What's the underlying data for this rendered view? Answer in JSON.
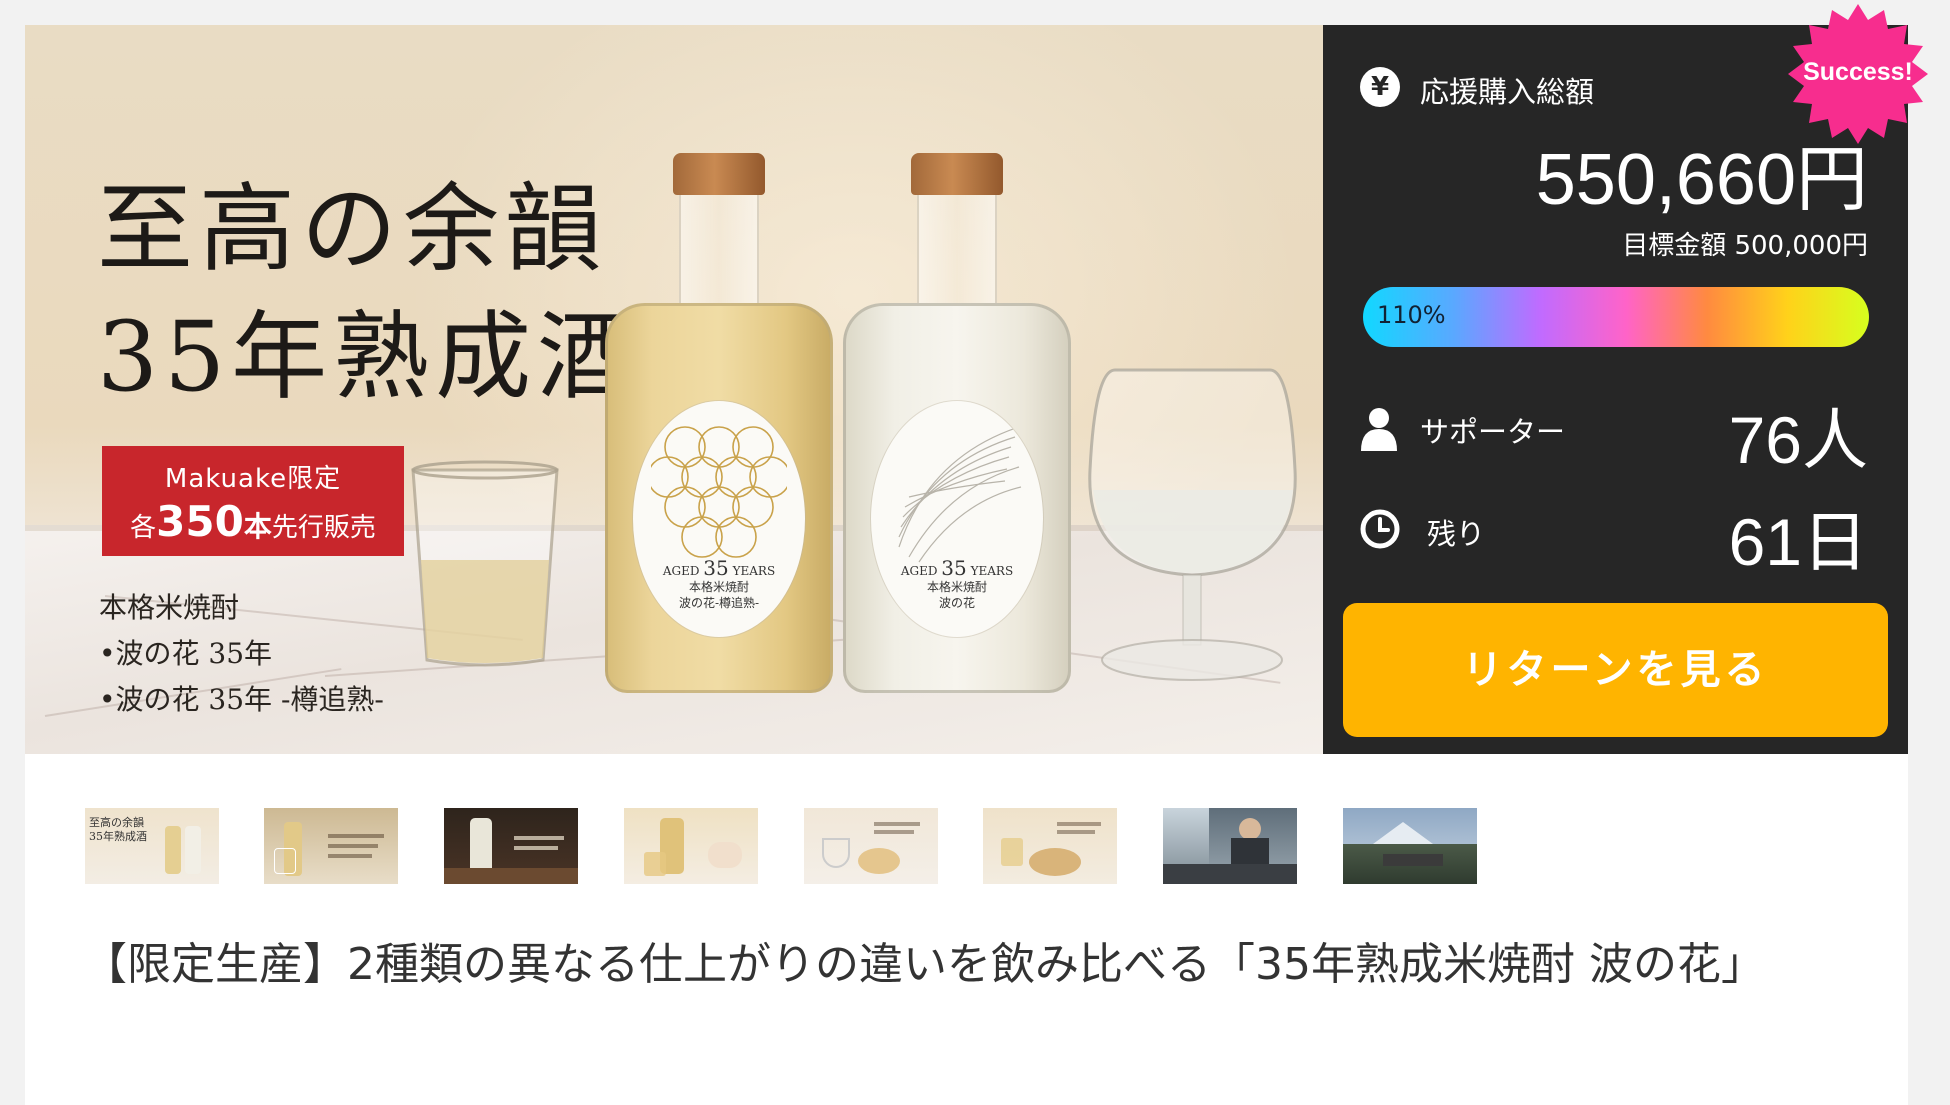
{
  "hero": {
    "title": "至高の余韻\n35年熟成酒",
    "badge_line1": "Makuake限定",
    "badge_prefix": "各",
    "badge_number": "350",
    "badge_unit": "本",
    "badge_suffix": "先行販売",
    "sub_lines": [
      "本格米焼酎",
      "•波の花 35年",
      "•波の花 35年 -樽追熟-"
    ],
    "bottle_left_label": [
      "AGED",
      "35",
      "YEARS",
      "本格米焼酎",
      "波の花-樽追熟-"
    ],
    "bottle_right_label": [
      "AGED",
      "35",
      "YEARS",
      "本格米焼酎",
      "波の花"
    ]
  },
  "panel": {
    "total_label": "応援購入総額",
    "total_icon": "yen-icon",
    "total_value": "550,660円",
    "goal_text": "目標金額 500,000円",
    "progress_percent": 110,
    "progress_label": "110%",
    "supporters_label": "サポーター",
    "supporters_icon": "person-icon",
    "supporters_value": "76人",
    "remaining_label": "残り",
    "remaining_icon": "clock-icon",
    "remaining_value": "61日",
    "cta_label": "リターンを見る",
    "success_label": "Success!",
    "colors": {
      "panel_bg": "#262626",
      "cta": "#ffb400",
      "success": "#f72d8e",
      "badge_red": "#c8262c"
    }
  },
  "thumbnails": [
    {
      "name": "thumb-1",
      "caption": "至高の余韻\n35年熟成酒"
    },
    {
      "name": "thumb-2",
      "caption": ""
    },
    {
      "name": "thumb-3",
      "caption": ""
    },
    {
      "name": "thumb-4",
      "caption": ""
    },
    {
      "name": "thumb-5",
      "caption": ""
    },
    {
      "name": "thumb-6",
      "caption": ""
    },
    {
      "name": "thumb-7",
      "caption": ""
    },
    {
      "name": "thumb-8",
      "caption": ""
    }
  ],
  "project": {
    "title": "【限定生産】2種類の異なる仕上がりの違いを飲み比べる「35年熟成米焼酎 波の花」"
  }
}
